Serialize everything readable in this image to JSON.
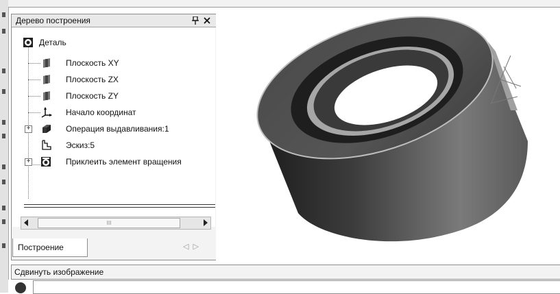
{
  "panel": {
    "title": "Дерево построения",
    "pin_icon": "pin-icon",
    "close_icon": "close-icon",
    "tree": [
      {
        "label": "Деталь",
        "icon": "part-icon"
      },
      {
        "label": "Плоскость XY",
        "icon": "plane-icon"
      },
      {
        "label": "Плоскость ZX",
        "icon": "plane-icon"
      },
      {
        "label": "Плоскость ZY",
        "icon": "plane-icon"
      },
      {
        "label": "Начало координат",
        "icon": "origin-axes-icon"
      },
      {
        "label": "Операция выдавливания:1",
        "icon": "extrude-icon"
      },
      {
        "label": "Эскиз:5",
        "icon": "sketch-icon"
      },
      {
        "label": "Приклеить элемент вращения",
        "icon": "revolve-icon"
      }
    ],
    "scroll_thumb": "III",
    "tab": "Построение"
  },
  "status": {
    "text": "Сдвинуть изображение"
  },
  "colors": {
    "panel_bg": "#f3f3f3",
    "tree_bg": "#ffffff",
    "ring_dark": "#3a3a3a",
    "ring_light": "#a0a0a0"
  }
}
